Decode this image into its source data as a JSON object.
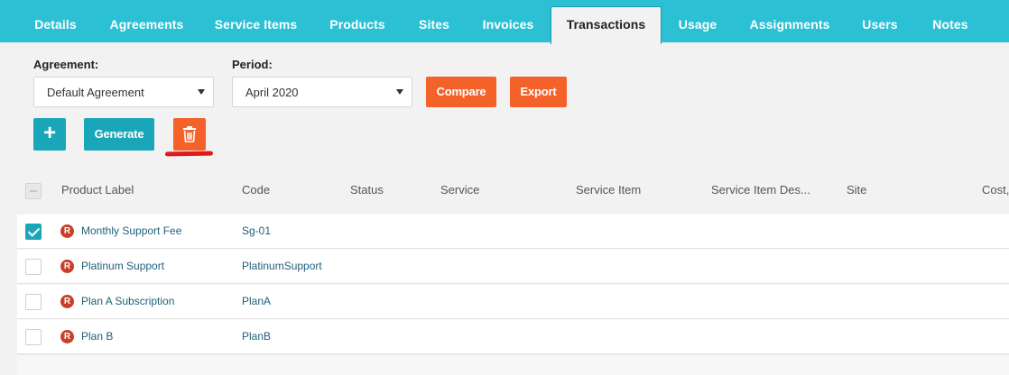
{
  "tabs": [
    {
      "label": "Details"
    },
    {
      "label": "Agreements"
    },
    {
      "label": "Service Items"
    },
    {
      "label": "Products"
    },
    {
      "label": "Sites"
    },
    {
      "label": "Invoices"
    },
    {
      "label": "Transactions",
      "active": true
    },
    {
      "label": "Usage"
    },
    {
      "label": "Assignments"
    },
    {
      "label": "Users"
    },
    {
      "label": "Notes"
    }
  ],
  "filters": {
    "agreement_label": "Agreement:",
    "agreement_value": "Default Agreement",
    "period_label": "Period:",
    "period_value": "April 2020"
  },
  "actions": {
    "compare_label": "Compare",
    "export_label": "Export",
    "add_label": "+",
    "generate_label": "Generate",
    "delete_icon": "trash-icon"
  },
  "table": {
    "columns": [
      "Product Label",
      "Code",
      "Status",
      "Service",
      "Service Item",
      "Service Item Des...",
      "Site",
      "Cost,"
    ],
    "rows": [
      {
        "badge": "R",
        "label": "Monthly Support Fee",
        "code": "Sg-01",
        "checked": true
      },
      {
        "badge": "R",
        "label": "Platinum Support",
        "code": "PlatinumSupport",
        "checked": false
      },
      {
        "badge": "R",
        "label": "Plan A Subscription",
        "code": "PlanA",
        "checked": false
      },
      {
        "badge": "R",
        "label": "Plan B",
        "code": "PlanB",
        "checked": false
      }
    ]
  },
  "colors": {
    "tab_bar": "#2bc0d3",
    "accent_teal": "#1aa6b9",
    "accent_orange": "#f4622a",
    "badge_red": "#c9402a",
    "link_blue": "#1f5f7a"
  }
}
